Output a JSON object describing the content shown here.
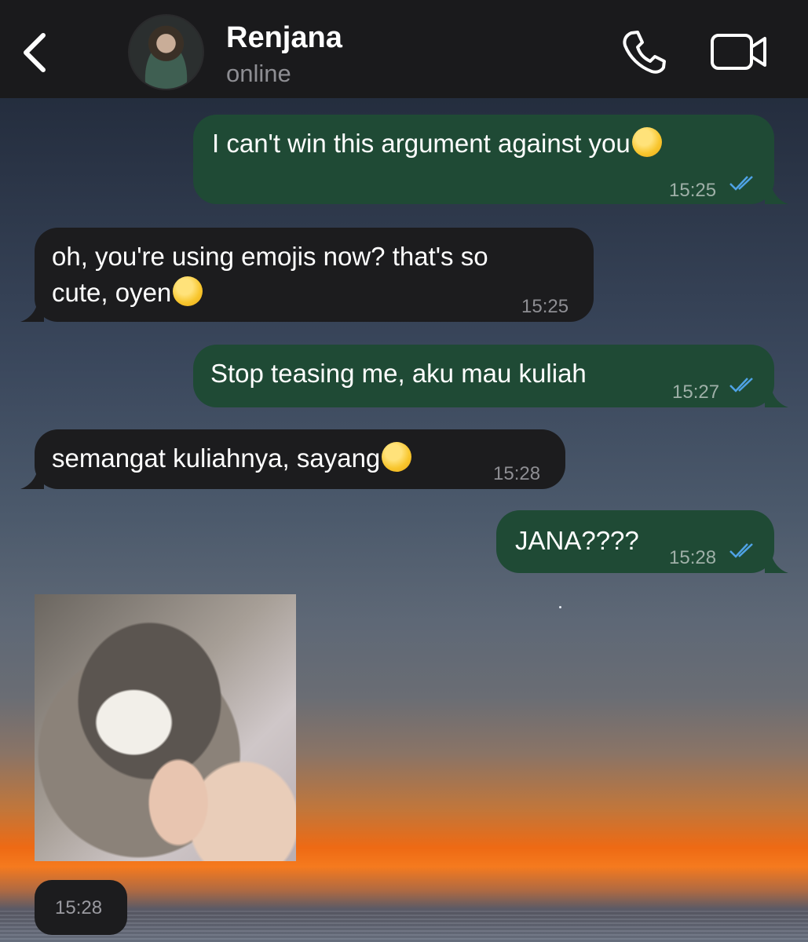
{
  "header": {
    "contact_name": "Renjana",
    "contact_status": "online",
    "icons": [
      "back-chevron-icon",
      "phone-icon",
      "video-camera-icon"
    ]
  },
  "messages": [
    {
      "direction": "out",
      "text": "I can't win this argument against you",
      "emoji": "exhaling-face-emoji",
      "time": "15:25",
      "status": "read"
    },
    {
      "direction": "in",
      "text_line1": "oh, you're using emojis now? that's so",
      "text_line2": "cute, oyen",
      "emoji": "pleading-face-emoji",
      "time": "15:25"
    },
    {
      "direction": "out",
      "text": "Stop teasing me, aku mau kuliah",
      "time": "15:27",
      "status": "read"
    },
    {
      "direction": "in",
      "text": "semangat kuliahnya, sayang",
      "emoji": "smiling-face-with-hearts-emoji",
      "time": "15:28"
    },
    {
      "direction": "out",
      "text": "JANA????",
      "time": "15:28",
      "status": "read"
    },
    {
      "direction": "in",
      "type": "sticker",
      "sticker": "kitten-biting-finger-sticker",
      "time": "15:28"
    }
  ],
  "colors": {
    "header_bg": "#1a1a1c",
    "outgoing_bubble": "#1f4a35",
    "incoming_bubble": "#1c1c1e",
    "read_ticks": "#4fa3e6",
    "timestamp": "#8e8e93"
  }
}
